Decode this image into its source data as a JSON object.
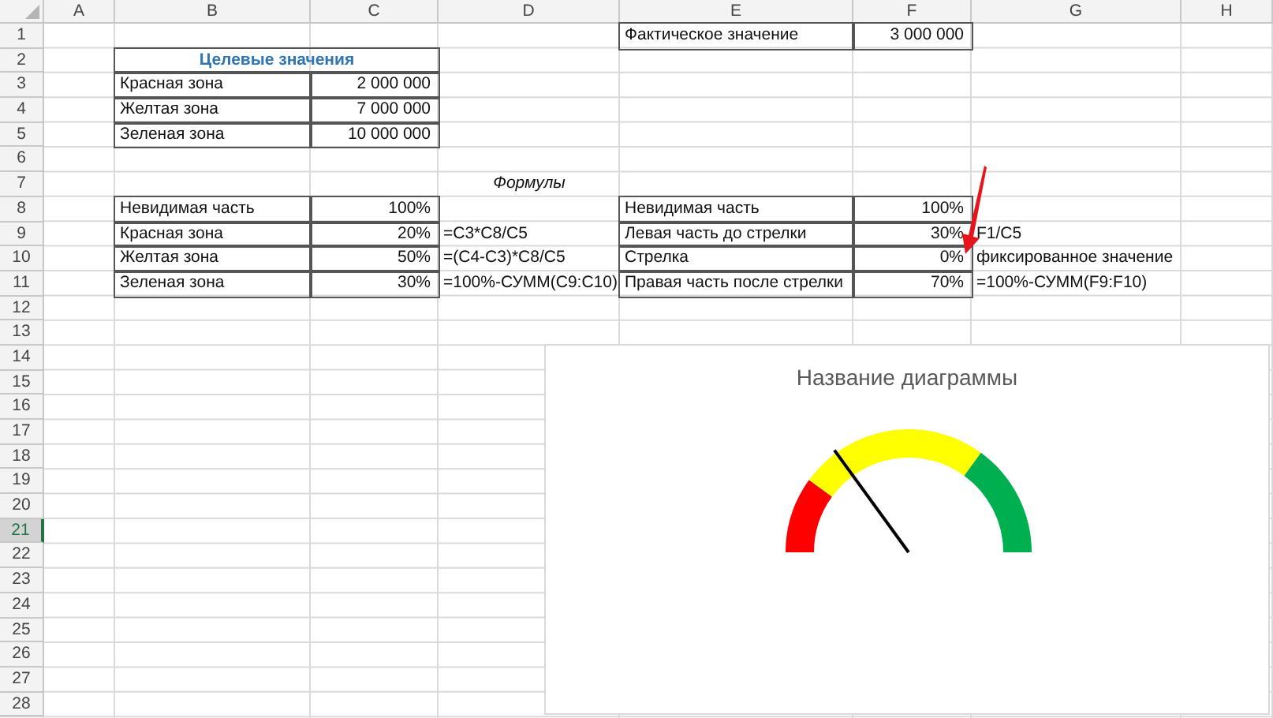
{
  "columns": [
    "A",
    "B",
    "C",
    "D",
    "E",
    "F",
    "G",
    "H"
  ],
  "rows": [
    {
      "number": "1",
      "selected": false,
      "cells": {
        "E": {
          "text": "Фактическое значение",
          "kind": "text",
          "bordered": true
        },
        "F": {
          "text": "3 000 000",
          "kind": "number",
          "bordered": true
        }
      }
    },
    {
      "number": "2",
      "selected": false,
      "cells": {
        "B": {
          "text": "Целевые значения",
          "kind": "heading",
          "bordered": true,
          "merged": true
        }
      }
    },
    {
      "number": "3",
      "selected": false,
      "cells": {
        "B": {
          "text": "Красная зона",
          "kind": "text",
          "bordered": true
        },
        "C": {
          "text": "2 000 000",
          "kind": "number",
          "bordered": true
        }
      }
    },
    {
      "number": "4",
      "selected": false,
      "cells": {
        "B": {
          "text": "Желтая зона",
          "kind": "text",
          "bordered": true
        },
        "C": {
          "text": "7 000 000",
          "kind": "number",
          "bordered": true
        }
      }
    },
    {
      "number": "5",
      "selected": false,
      "cells": {
        "B": {
          "text": "Зеленая зона",
          "kind": "text",
          "bordered": true
        },
        "C": {
          "text": "10 000 000",
          "kind": "number",
          "bordered": true
        }
      }
    },
    {
      "number": "6",
      "selected": false
    },
    {
      "number": "7",
      "selected": false,
      "cells": {
        "D": {
          "text": "Формулы",
          "kind": "caption",
          "bordered": false
        }
      }
    },
    {
      "number": "8",
      "selected": false,
      "cells": {
        "B": {
          "text": "Невидимая часть",
          "kind": "text",
          "bordered": true
        },
        "C": {
          "text": "100%",
          "kind": "number",
          "bordered": true
        },
        "E": {
          "text": "Невидимая часть",
          "kind": "text",
          "bordered": true
        },
        "F": {
          "text": "100%",
          "kind": "number",
          "bordered": true
        }
      }
    },
    {
      "number": "9",
      "selected": false,
      "cells": {
        "B": {
          "text": "Красная зона",
          "kind": "text",
          "bordered": true
        },
        "C": {
          "text": "20%",
          "kind": "number",
          "bordered": true
        },
        "D": {
          "text": "=C3*C8/C5",
          "kind": "text",
          "bordered": false
        },
        "E": {
          "text": "Левая часть до стрелки",
          "kind": "text",
          "bordered": true
        },
        "F": {
          "text": "30%",
          "kind": "number",
          "bordered": true
        },
        "G": {
          "text": "F1/C5",
          "kind": "text",
          "bordered": false
        }
      }
    },
    {
      "number": "10",
      "selected": false,
      "cells": {
        "B": {
          "text": "Желтая зона",
          "kind": "text",
          "bordered": true
        },
        "C": {
          "text": "50%",
          "kind": "number",
          "bordered": true
        },
        "D": {
          "text": "=(C4-C3)*C8/C5",
          "kind": "text",
          "bordered": false
        },
        "E": {
          "text": "Стрелка",
          "kind": "text",
          "bordered": true
        },
        "F": {
          "text": "0%",
          "kind": "number",
          "bordered": true
        },
        "G": {
          "text": "фиксированное значение",
          "kind": "text",
          "bordered": false
        }
      }
    },
    {
      "number": "11",
      "selected": false,
      "cells": {
        "B": {
          "text": "Зеленая зона",
          "kind": "text",
          "bordered": true
        },
        "C": {
          "text": "30%",
          "kind": "number",
          "bordered": true
        },
        "D": {
          "text": "=100%-СУММ(C9:C10)",
          "kind": "text",
          "bordered": false
        },
        "E": {
          "text": "Правая часть после стрелки",
          "kind": "text",
          "bordered": true
        },
        "F": {
          "text": "70%",
          "kind": "number",
          "bordered": true
        },
        "G": {
          "text": "=100%-СУММ(F9:F10)",
          "kind": "text",
          "bordered": false
        }
      }
    },
    {
      "number": "12",
      "selected": false
    },
    {
      "number": "13",
      "selected": false
    },
    {
      "number": "14",
      "selected": false
    },
    {
      "number": "15",
      "selected": false
    },
    {
      "number": "16",
      "selected": false
    },
    {
      "number": "17",
      "selected": false
    },
    {
      "number": "18",
      "selected": false
    },
    {
      "number": "19",
      "selected": false
    },
    {
      "number": "20",
      "selected": false
    },
    {
      "number": "21",
      "selected": true
    },
    {
      "number": "22",
      "selected": false
    },
    {
      "number": "23",
      "selected": false
    },
    {
      "number": "24",
      "selected": false
    },
    {
      "number": "25",
      "selected": false
    },
    {
      "number": "26",
      "selected": false
    },
    {
      "number": "27",
      "selected": false
    },
    {
      "number": "28",
      "selected": false
    }
  ],
  "chart": {
    "title": "Название диаграммы"
  }
}
